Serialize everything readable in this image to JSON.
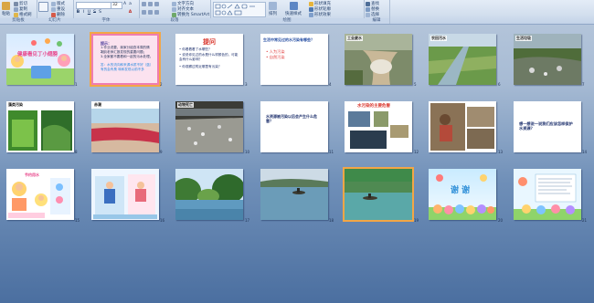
{
  "ribbon": {
    "clipboard": {
      "name": "剪贴板",
      "paste": "粘贴",
      "cut": "剪切",
      "copy": "复制",
      "format": "格式刷"
    },
    "slides": {
      "name": "幻灯片",
      "new_slide": "新建幻灯片",
      "layout": "版式",
      "reset": "重设",
      "delete": "删除"
    },
    "font": {
      "name": "字体",
      "font_name": "",
      "font_size": "32"
    },
    "paragraph": {
      "name": "段落",
      "text_direction": "文字方向",
      "align_text": "对齐文本",
      "smartart": "转换为 SmartArt"
    },
    "drawing": {
      "name": "绘图",
      "arrange": "排列",
      "quick_styles": "快速样式",
      "fill": "形状填充",
      "outline": "形状轮廓",
      "effects": "形状效果"
    },
    "editing": {
      "name": "编辑",
      "find": "查找",
      "replace": "替换",
      "select": "选择"
    }
  },
  "slides": [
    {
      "num": "1",
      "title": "健康看见丁小翅膀"
    },
    {
      "num": "2",
      "title": "提示：",
      "lines": [
        "1.作业说要，我家分组查本周的情况；",
        "2.向老师汇报发现的重要问题；",
        "3.全家都不要看和一起的污水处理。",
        "答：水的流向和来源水质不好（蓝）有的会有臭 味和发现以前不多"
      ]
    },
    {
      "num": "3",
      "title": "提问",
      "lines": [
        "• 你看着看了水哪些？",
        "• 说说你见过的水是什么样颜色的，可能会有什么影响？",
        "• 你观察过附近哪里有污染？"
      ]
    },
    {
      "num": "4",
      "title": "生活中常见过的水污染有哪些？",
      "lines": [
        "• 人为污染",
        "• 自然污染"
      ]
    },
    {
      "num": "5",
      "title": "工业废水"
    },
    {
      "num": "6",
      "title": "农田污水"
    },
    {
      "num": "7",
      "title": "生活垃圾"
    },
    {
      "num": "8",
      "title": "藻类污染"
    },
    {
      "num": "9",
      "title": "赤潮"
    },
    {
      "num": "10",
      "title": "动物死亡"
    },
    {
      "num": "11",
      "title": "水资源被污染以后会产生什么危害？"
    },
    {
      "num": "12",
      "title": "水污染的主要危害"
    },
    {
      "num": "13",
      "title": ""
    },
    {
      "num": "14",
      "title": "想一想说一说我们应该怎样保护水资源？"
    },
    {
      "num": "15",
      "title": "节约用水"
    },
    {
      "num": "16",
      "title": ""
    },
    {
      "num": "17",
      "title": ""
    },
    {
      "num": "18",
      "title": ""
    },
    {
      "num": "19",
      "title": ""
    },
    {
      "num": "20",
      "title": "谢 谢"
    },
    {
      "num": "21",
      "title": ""
    }
  ]
}
